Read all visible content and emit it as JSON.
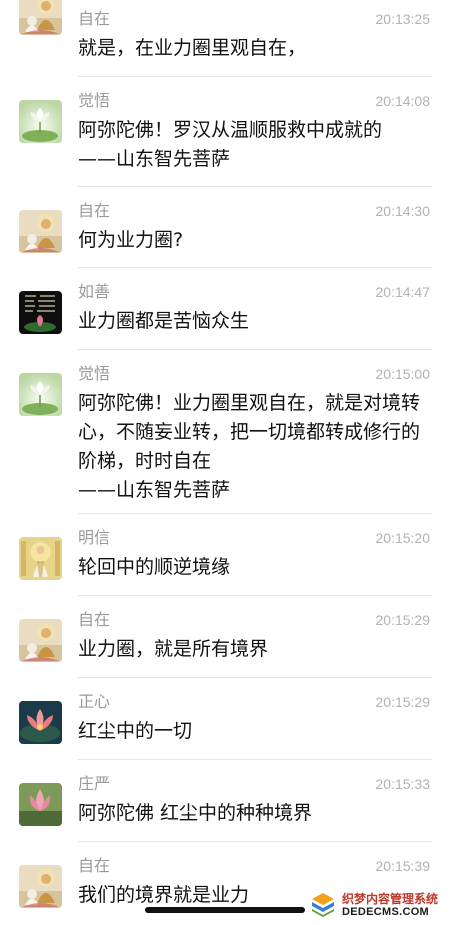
{
  "messages": [
    {
      "avatar": "buddha-lotus-avatar",
      "name": "自在",
      "time": "20:13:25",
      "lines": [
        "就是，在业力圈里观自在，"
      ]
    },
    {
      "avatar": "white-lotus-avatar",
      "name": "觉悟",
      "time": "20:14:08",
      "lines": [
        "阿弥陀佛！罗汉从温顺服救中成就的",
        "——山东智先菩萨"
      ]
    },
    {
      "avatar": "buddha-lotus-avatar",
      "name": "自在",
      "time": "20:14:30",
      "lines": [
        "何为业力圈?"
      ]
    },
    {
      "avatar": "calligraphy-lotus-avatar",
      "name": "如善",
      "time": "20:14:47",
      "lines": [
        "业力圈都是苦恼众生"
      ]
    },
    {
      "avatar": "white-lotus-avatar",
      "name": "觉悟",
      "time": "20:15:00",
      "lines": [
        "阿弥陀佛！业力圈里观自在，就是对境转",
        "心，不随妄业转，把一切境都转成修行的",
        "阶梯，时时自在",
        "——山东智先菩萨"
      ]
    },
    {
      "avatar": "guanyin-avatar",
      "name": "明信",
      "time": "20:15:20",
      "lines": [
        "轮回中的顺逆境缘"
      ]
    },
    {
      "avatar": "buddha-lotus-avatar",
      "name": "自在",
      "time": "20:15:29",
      "lines": [
        "业力圈，就是所有境界"
      ]
    },
    {
      "avatar": "pink-lotus-avatar",
      "name": "正心",
      "time": "20:15:29",
      "lines": [
        "红尘中的一切"
      ]
    },
    {
      "avatar": "lotus-flower-avatar",
      "name": "庄严",
      "time": "20:15:33",
      "lines": [
        "阿弥陀佛 红尘中的种种境界"
      ]
    },
    {
      "avatar": "buddha-lotus-avatar",
      "name": "自在",
      "time": "20:15:39",
      "lines": [
        "我们的境界就是业力"
      ]
    }
  ],
  "watermark": {
    "title": "织梦内容管理系统",
    "url": "DEDECMS.COM"
  },
  "colors": {
    "name": "#9a9a9a",
    "time": "#b2b2b2",
    "text": "#111111",
    "divider": "#e6e6e6"
  }
}
